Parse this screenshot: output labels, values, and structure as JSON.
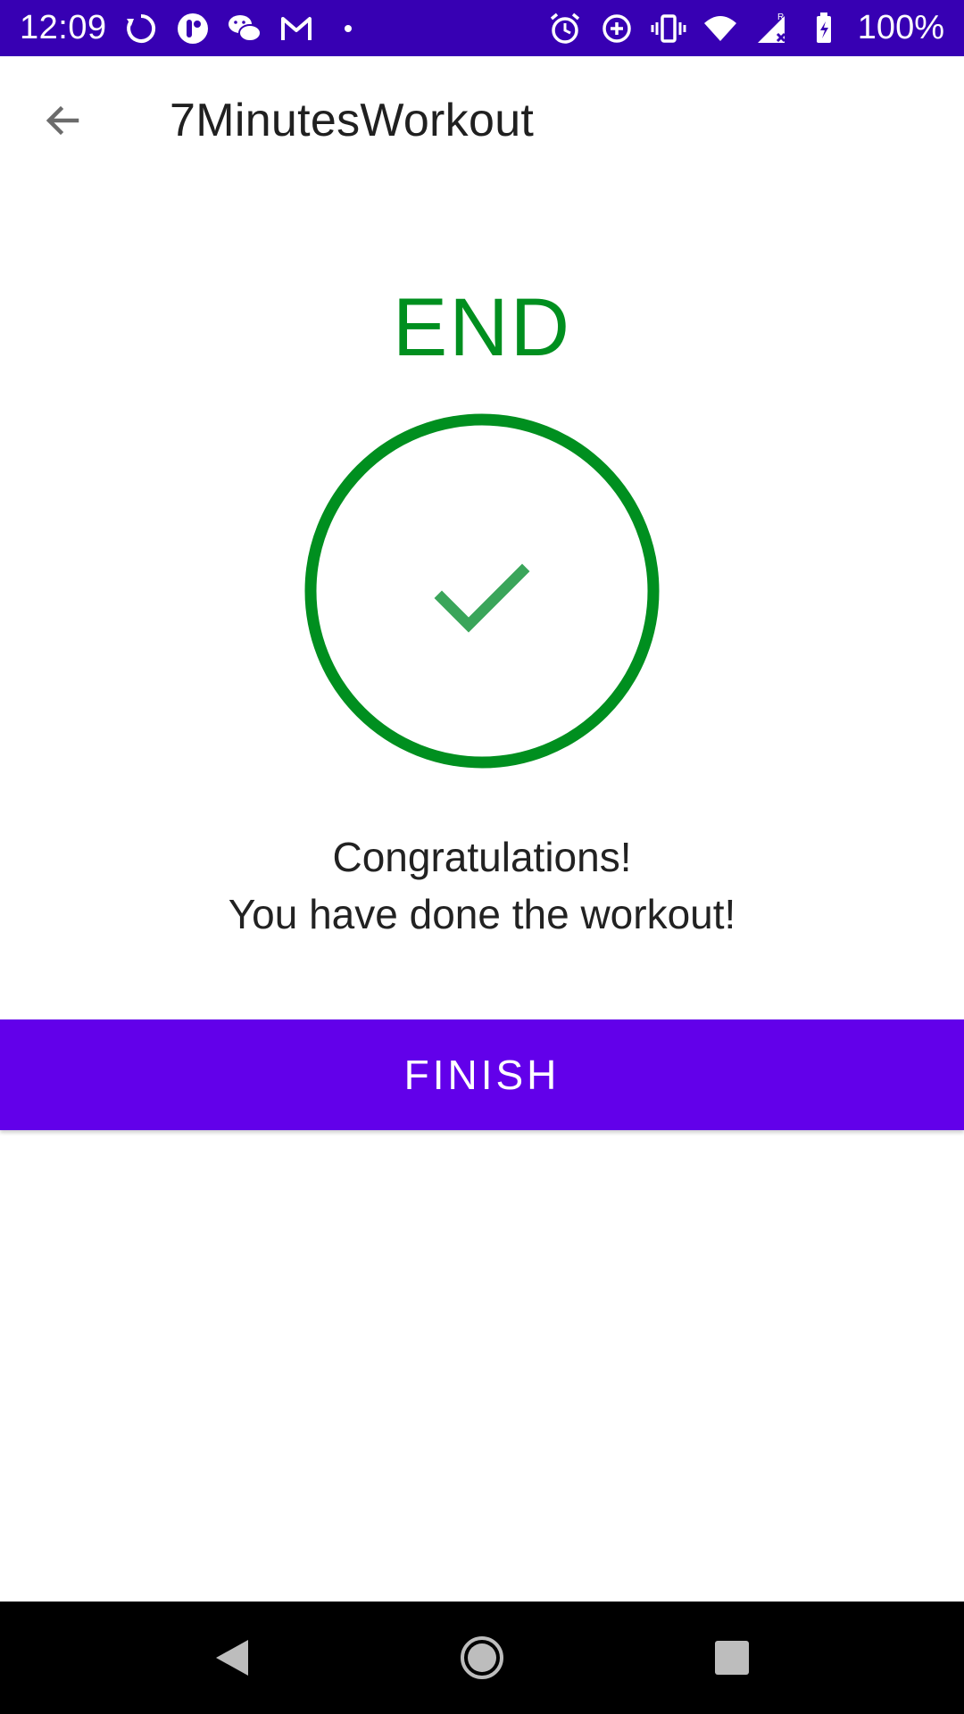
{
  "status_bar": {
    "time": "12:09",
    "battery": "100%",
    "color": "#3700b3",
    "left_icons": [
      "sync-icon",
      "app-notification-icon",
      "wechat-icon",
      "gmail-icon",
      "more-dot-icon"
    ],
    "right_icons": [
      "alarm-icon",
      "data-saver-icon",
      "vibrate-icon",
      "wifi-icon",
      "signal-icon",
      "battery-icon"
    ]
  },
  "app_bar": {
    "title": "7MinutesWorkout",
    "back_icon": "arrow-back-icon"
  },
  "main": {
    "heading": "END",
    "heading_color": "#008f1f",
    "check_icon": "check-icon",
    "message_line1": "Congratulations!",
    "message_line2": "You have done the workout!"
  },
  "finish_button": {
    "label": "FINISH",
    "color": "#6200ea"
  },
  "nav_bar": {
    "back": "nav-back-icon",
    "home": "nav-home-icon",
    "recents": "nav-recents-icon"
  }
}
